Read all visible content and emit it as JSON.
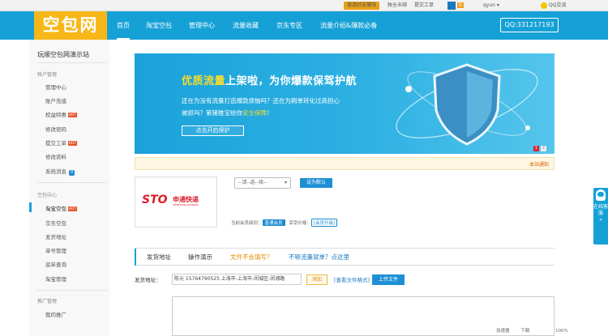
{
  "topbar": {
    "invite": "邀请好友赚钱",
    "bind_send": "独全未绑",
    "submit_ticket": "提交工单",
    "balance": "0",
    "user": "qyun",
    "qq_chat": "QQ交谈"
  },
  "header": {
    "logo": "空包网",
    "nav": [
      "首页",
      "淘宝空包",
      "管理中心",
      "流量收藏",
      "京东专区",
      "流量介绍&爆款必备"
    ],
    "qq": "QQ:331217193"
  },
  "sidebar": {
    "title": "玩顺空包网演示站",
    "groups": [
      {
        "label": "帐户管理",
        "items": [
          "管理中心",
          "账户充值",
          "权益特惠",
          "修改密码",
          "提交工单",
          "修改资料",
          "系统消息"
        ]
      },
      {
        "label": "空包中心",
        "items": [
          "淘宝空包",
          "京东空包",
          "发货地址",
          "单号管理",
          "底单查询",
          "淘宝管理"
        ]
      },
      {
        "label": "推广管理",
        "items": [
          "我的推广"
        ]
      }
    ],
    "hot_label": "HOT",
    "message_count": "0"
  },
  "banner": {
    "title_hl": "优质流量",
    "title_rest": "上架啦，为你爆款保驾护航",
    "line1": "还在为没有流量打造爆款烦恼吗？还在为刷单转化过高担心",
    "line2_a": "被抓吗？第猪推宝给你",
    "line2_hl": "安全保障",
    "line2_b": "！",
    "button": "点击开启保护",
    "dots": [
      "1",
      "2"
    ]
  },
  "notice": {
    "text": "本站通知"
  },
  "express": {
    "logo_text": "STO",
    "name_cn": "申通快递",
    "name_en": "SHENTONG EXPRESS",
    "select": "--请--选--择--",
    "set_default": "设为默认",
    "level_label": "当前会员级别：",
    "level": "普通会员",
    "price_label": "享受价格：",
    "price": "[会员升级]"
  },
  "tabs": [
    "发货地址",
    "操作演示",
    "文件不会填写？",
    "不够流量就单？点这里"
  ],
  "form": {
    "address_label": "发货地址：",
    "address_value": "陈元 15764790525 上海市-上海市-闵城区-闵浦路",
    "add_button": "添加",
    "format_link": "[查看文件格式]",
    "upload_button": "上传文件"
  },
  "status": {
    "zoom": "加速器",
    "settings": "下载",
    "zoom_level": "100%"
  },
  "float_service": {
    "text": "在线客服"
  }
}
